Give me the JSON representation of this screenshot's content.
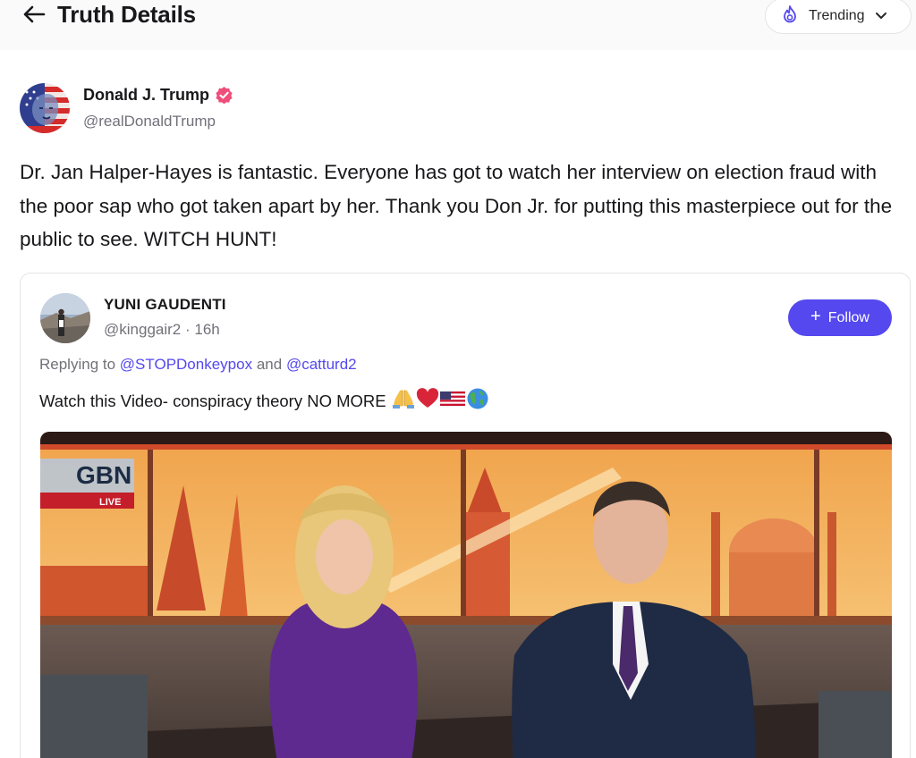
{
  "header": {
    "title": "Truth Details",
    "back_icon": "arrow-left-icon",
    "trending": {
      "label": "Trending",
      "icon": "flame-icon",
      "chevron": "chevron-down-icon"
    }
  },
  "post": {
    "author": {
      "name": "Donald J. Trump",
      "handle": "@realDonaldTrump",
      "verified": true
    },
    "text": "Dr. Jan Halper-Hayes is fantastic. Everyone has got to watch her interview on election fraud with the poor sap who got taken apart by her. Thank you Don Jr. for putting this masterpiece out for the public to see. WITCH HUNT!"
  },
  "quote": {
    "author": {
      "name": "YUNI GAUDENTI",
      "handle": "@kinggair2",
      "separator": " · ",
      "time": "16h"
    },
    "follow_label": "Follow",
    "reply": {
      "prefix": "Replying to",
      "mention1": "@STOPDonkeypox",
      "joiner": "and",
      "mention2": "@catturd2"
    },
    "text": "Watch this Video- conspiracy theory NO MORE",
    "emojis": [
      "praying-hands-icon",
      "red-heart-icon",
      "us-flag-icon",
      "globe-americas-icon"
    ],
    "video": {
      "logo_text": "GBN",
      "live_label": "LIVE"
    }
  },
  "colors": {
    "accent": "#5448ee",
    "muted": "#71717a",
    "text": "#18181b",
    "verified": "#ef4d7a"
  }
}
